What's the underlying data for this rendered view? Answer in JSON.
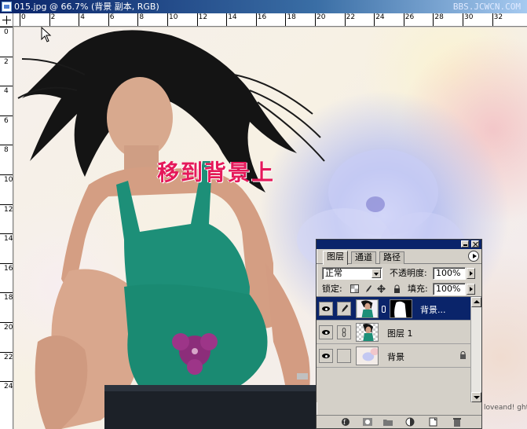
{
  "window": {
    "title": "015.jpg @ 66.7% (背景 副本, RGB)",
    "watermark": "BBS.JCWCN.COM"
  },
  "ruler": {
    "top_labels": [
      "0",
      "2",
      "4",
      "6",
      "8",
      "10",
      "12",
      "14",
      "16",
      "18",
      "20",
      "22",
      "24",
      "26",
      "28",
      "30",
      "32"
    ],
    "left_labels": [
      "0",
      "2",
      "4",
      "6",
      "8",
      "10",
      "12",
      "14",
      "16",
      "18",
      "20",
      "22",
      "24"
    ]
  },
  "canvas": {
    "caption": "移到背景上",
    "caption_color": "#e5195a",
    "corner_note": "loveand! ght-j"
  },
  "layers_panel": {
    "tabs": [
      {
        "label": "图层",
        "active": true
      },
      {
        "label": "通道",
        "active": false
      },
      {
        "label": "路径",
        "active": false
      }
    ],
    "blend_mode": "正常",
    "opacity_label": "不透明度:",
    "opacity_value": "100%",
    "lock_label": "锁定:",
    "fill_label": "填充:",
    "fill_value": "100%",
    "layers": [
      {
        "name": "背景...",
        "selected": true,
        "visible": true,
        "has_mask": true
      },
      {
        "name": "图层 1",
        "selected": false,
        "visible": true,
        "has_mask": false
      },
      {
        "name": "背景",
        "selected": false,
        "visible": true,
        "locked": true
      }
    ],
    "selection_color": "#0a246a"
  }
}
